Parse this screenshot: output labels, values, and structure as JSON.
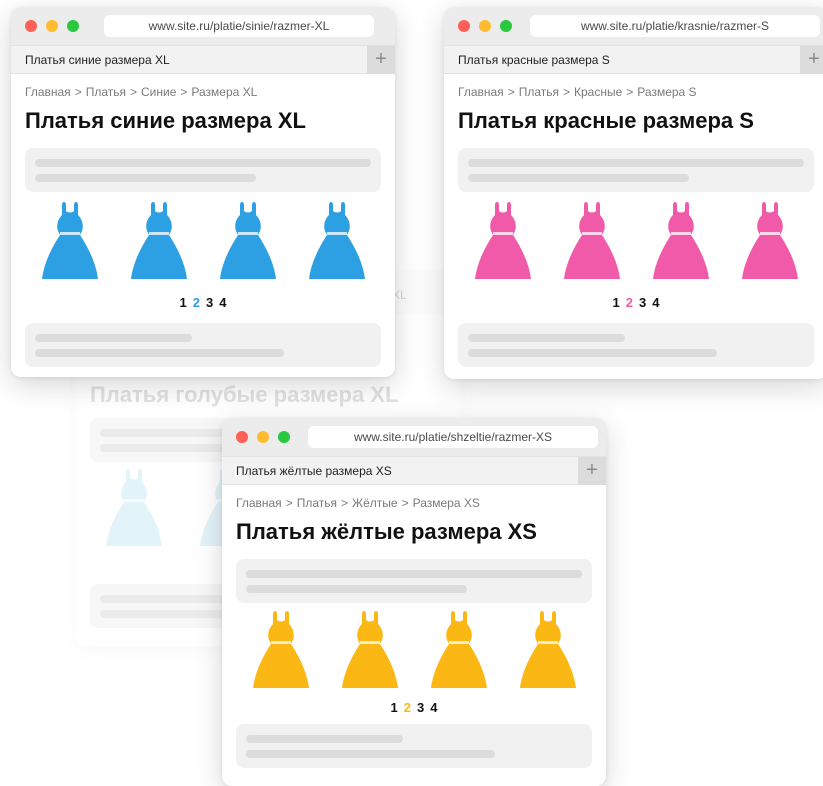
{
  "colors": {
    "blue": "#2d9fe3",
    "pink": "#f05aa8",
    "yellow": "#fbb714",
    "ghost_blue": "#cdeaf7"
  },
  "ghost": {
    "tab_fragment": "XL",
    "title": "Платья голубые размера XL"
  },
  "windows": [
    {
      "url": "www.site.ru/platie/sinie/razmer-XL",
      "tab": "Платья синие размера XL",
      "breadcrumb": [
        "Главная",
        "Платья",
        "Синие",
        "Размера XL"
      ],
      "breadcrumb_sep": ">",
      "title": "Платья синие размера XL",
      "dress_color": "blue",
      "pages": [
        "1",
        "2",
        "3",
        "4"
      ],
      "active_page": "2"
    },
    {
      "url": "www.site.ru/platie/krasnie/razmer-S",
      "tab": "Платья красные размера S",
      "breadcrumb": [
        "Главная",
        "Платья",
        "Красные",
        "Размера S"
      ],
      "breadcrumb_sep": ">",
      "title": "Платья красные размера S",
      "dress_color": "pink",
      "pages": [
        "1",
        "2",
        "3",
        "4"
      ],
      "active_page": "2"
    },
    {
      "url": "www.site.ru/platie/shzeltie/razmer-XS",
      "tab": "Платья жёлтые размера XS",
      "breadcrumb": [
        "Главная",
        "Платья",
        "Жёлтые",
        "Размера XS"
      ],
      "breadcrumb_sep": ">",
      "title": "Платья жёлтые размера XS",
      "dress_color": "yellow",
      "pages": [
        "1",
        "2",
        "3",
        "4"
      ],
      "active_page": "2"
    }
  ],
  "new_tab_symbol": "+"
}
